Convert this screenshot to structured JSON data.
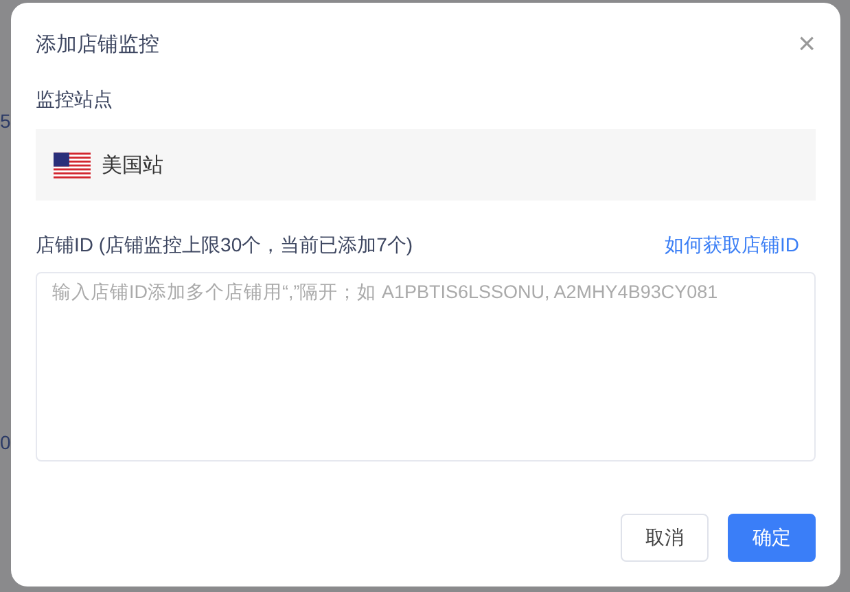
{
  "background_fragments": [
    "5",
    "0"
  ],
  "dialog": {
    "title": "添加店铺监控",
    "close": "×",
    "site_label": "监控站点",
    "site": {
      "name": "美国站"
    },
    "id_label": "店铺ID (店铺监控上限30个，当前已添加7个)",
    "help_link": "如何获取店铺ID",
    "input": {
      "placeholder": "输入店铺ID添加多个店铺用“,”隔开；如 A1PBTIS6LSSONU, A2MHY4B93CY081"
    },
    "buttons": [
      {
        "label": "取消",
        "kind": "secondary"
      },
      {
        "label": "确定",
        "kind": "primary"
      }
    ]
  }
}
